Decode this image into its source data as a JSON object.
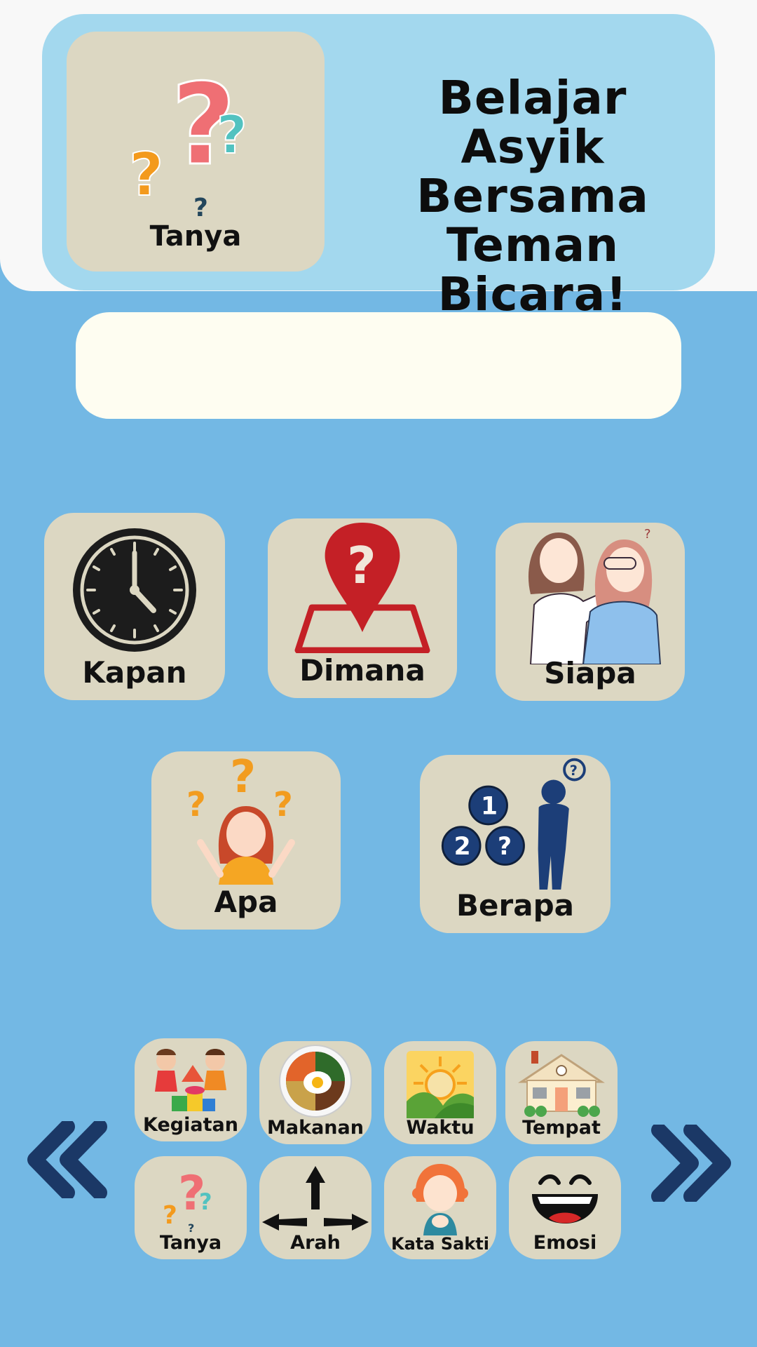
{
  "header": {
    "hero_label": "Tanya",
    "title_line1": "Belajar Asyik",
    "title_line2": "Bersama",
    "title_line3": "Teman Bicara!"
  },
  "sentence_bar": {
    "text": ""
  },
  "question_words": [
    {
      "label": "Kapan",
      "icon": "clock-icon"
    },
    {
      "label": "Dimana",
      "icon": "location-pin-icon"
    },
    {
      "label": "Siapa",
      "icon": "guess-who-icon"
    },
    {
      "label": "Apa",
      "icon": "confused-girl-icon"
    },
    {
      "label": "Berapa",
      "icon": "counting-person-icon"
    }
  ],
  "categories": [
    {
      "label": "Kegiatan",
      "icon": "kids-playing-icon"
    },
    {
      "label": "Makanan",
      "icon": "food-plate-icon"
    },
    {
      "label": "Waktu",
      "icon": "sun-landscape-icon"
    },
    {
      "label": "Tempat",
      "icon": "house-icon"
    },
    {
      "label": "Tanya",
      "icon": "question-marks-icon"
    },
    {
      "label": "Arah",
      "icon": "direction-arrows-icon"
    },
    {
      "label": "Kata Sakti",
      "icon": "girl-hands-icon"
    },
    {
      "label": "Emosi",
      "icon": "laughing-face-icon"
    }
  ],
  "colors": {
    "background": "#73b8e4",
    "header_panel": "#a3d8ee",
    "card": "#dcd7c2",
    "sentence_bar": "#fefdf1",
    "nav_arrow": "#1b3866"
  }
}
